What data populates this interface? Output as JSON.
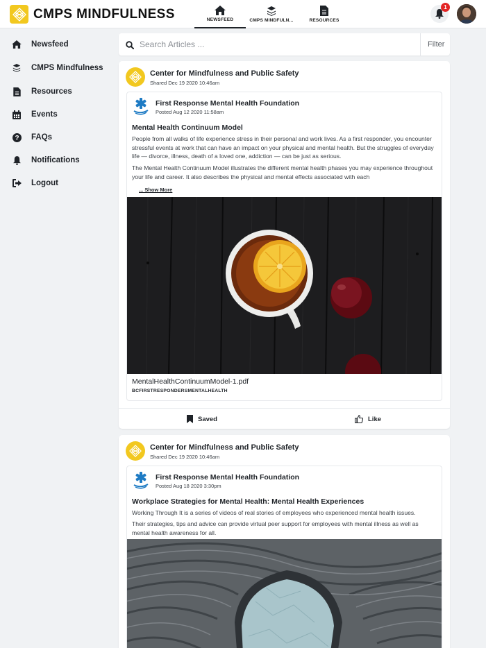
{
  "app": {
    "brand": "CMPS MINDFULNESS",
    "logo_icon": "lotus-diamond-icon",
    "accent": "#f2c81f"
  },
  "topnav": {
    "tabs": [
      {
        "label": "NEWSFEED",
        "icon": "home-icon",
        "active": true
      },
      {
        "label": "CMPS MINDFULN...",
        "icon": "layers-icon",
        "active": false
      },
      {
        "label": "RESOURCES",
        "icon": "document-icon",
        "active": false
      }
    ],
    "notifications_count": "1"
  },
  "sidebar": {
    "items": [
      {
        "label": "Newsfeed",
        "icon": "home-icon"
      },
      {
        "label": "CMPS Mindfulness",
        "icon": "layers-icon"
      },
      {
        "label": "Resources",
        "icon": "document-icon"
      },
      {
        "label": "Events",
        "icon": "calendar-icon"
      },
      {
        "label": "FAQs",
        "icon": "question-icon"
      },
      {
        "label": "Notifications",
        "icon": "bell-icon"
      },
      {
        "label": "Logout",
        "icon": "logout-icon"
      }
    ]
  },
  "search": {
    "placeholder": "Search Articles ...",
    "filter_label": "Filter"
  },
  "posts": [
    {
      "org_name": "Center for Mindfulness and Public Safety",
      "shared": "Shared Dec 19 2020 10:46am",
      "source_name": "First Response Mental Health Foundation",
      "posted": "Posted Aug 12 2020 11:58am",
      "title": "Mental Health Continuum Model",
      "paragraph1": "People from all walks of life experience stress in their personal and work lives. As a first responder, you encounter stressful events at work that can have an impact on your physical and mental health. But the struggles of everyday life — divorce, illness, death of a loved one, addiction — can be just as serious.",
      "paragraph2": "The Mental Health Continuum Model illustrates the different mental health phases you may experience throughout your life and career. It also describes the physical and mental effects associated with each",
      "show_more": "... Show More",
      "file_name": "MentalHealthContinuumModel-1.pdf",
      "file_tag": "BCFIRSTRESPONDERSMENTALHEALTH",
      "saved_label": "Saved",
      "like_label": "Like"
    },
    {
      "org_name": "Center for Mindfulness and Public Safety",
      "shared": "Shared Dec 19 2020 10:46am",
      "source_name": "First Response Mental Health Foundation",
      "posted": "Posted Aug 18 2020 3:30pm",
      "title": "Workplace Strategies for Mental Health: Mental Health Experiences",
      "paragraph1": "Working Through It is a series of videos of real stories of employees who experienced mental health issues.",
      "paragraph2": "Their strategies, tips and advice can provide virtual peer support for employees with mental illness as well as mental health awareness for all."
    }
  ]
}
